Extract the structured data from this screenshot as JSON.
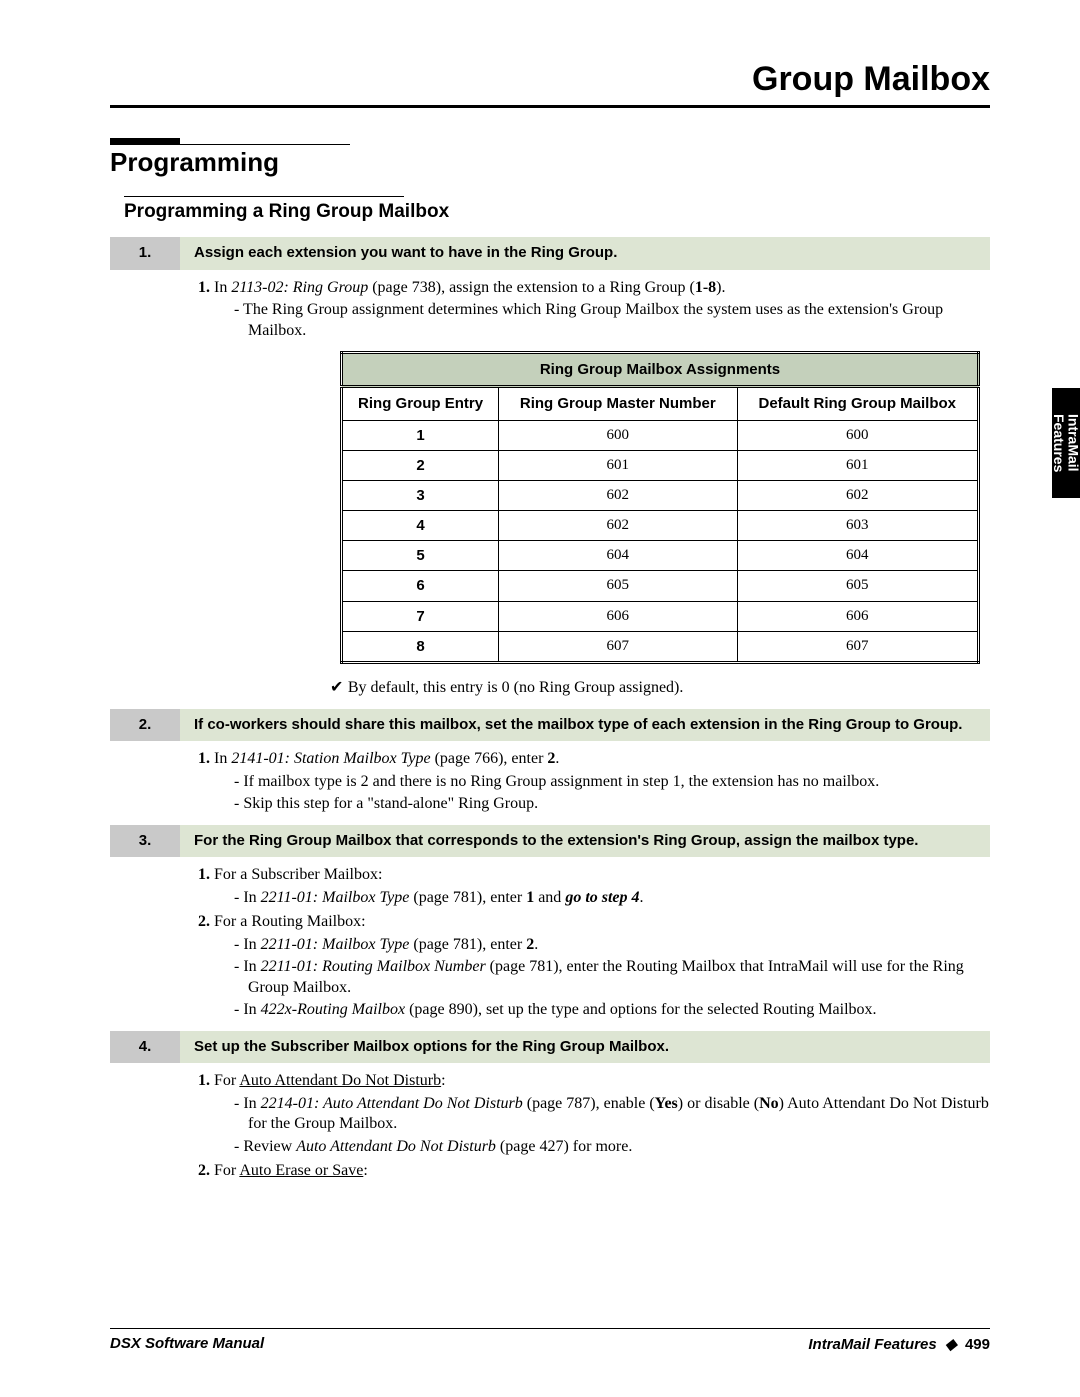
{
  "chapter_title": "Group Mailbox",
  "section_title": "Programming",
  "subsection_title": "Programming a Ring Group Mailbox",
  "sidetab": {
    "line1": "IntraMail",
    "line2": "Features"
  },
  "footer": {
    "left": "DSX Software Manual",
    "right_label": "IntraMail Features",
    "sep": "◆",
    "page": "499"
  },
  "steps": [
    {
      "num": "1.",
      "text": "Assign each extension you want to have in the Ring Group."
    },
    {
      "num": "2.",
      "text": "If co-workers should share this mailbox, set the mailbox type of each extension in the Ring Group to Group."
    },
    {
      "num": "3.",
      "text": "For the Ring Group Mailbox that corresponds to the extension's Ring Group, assign the mailbox type."
    },
    {
      "num": "4.",
      "text": "Set up the Subscriber Mailbox options for the Ring Group Mailbox."
    }
  ],
  "s1": {
    "lead_a": "In ",
    "lead_ref": "2113-02: Ring Group",
    "lead_b": " (page 738), assign the extension to a Ring Group (",
    "range": "1-8",
    "lead_c": ").",
    "dash1": "The Ring Group assignment determines which Ring Group Mailbox the system uses as the extension's Group Mailbox.",
    "note": "By default, this entry is 0 (no Ring Group assigned)."
  },
  "table": {
    "title": "Ring Group Mailbox Assignments",
    "cols": [
      "Ring Group Entry",
      "Ring Group Master Number",
      "Default Ring Group Mailbox"
    ],
    "rows": [
      [
        "1",
        "600",
        "600"
      ],
      [
        "2",
        "601",
        "601"
      ],
      [
        "3",
        "602",
        "602"
      ],
      [
        "4",
        "602",
        "603"
      ],
      [
        "5",
        "604",
        "604"
      ],
      [
        "6",
        "605",
        "605"
      ],
      [
        "7",
        "606",
        "606"
      ],
      [
        "8",
        "607",
        "607"
      ]
    ]
  },
  "s2": {
    "lead_a": "In ",
    "lead_ref": "2141-01: Station Mailbox Type",
    "lead_b": " (page 766), enter ",
    "val": "2",
    "lead_c": ".",
    "dash1": "If mailbox type is 2 and there is no Ring Group assignment in step 1, the extension has no mailbox.",
    "dash2": "Skip this step for a \"stand-alone\" Ring Group."
  },
  "s3": {
    "l1": "For a Subscriber Mailbox:",
    "l1d_a": "In ",
    "l1d_ref": "2211-01: Mailbox Type",
    "l1d_b": " (page 781), enter ",
    "l1d_v": "1",
    "l1d_c": " and ",
    "l1d_go": "go to step 4",
    "l1d_d": ".",
    "l2": "For a Routing Mailbox:",
    "l2d1_a": "In ",
    "l2d1_ref": "2211-01: Mailbox Type",
    "l2d1_b": " (page 781), enter ",
    "l2d1_v": "2",
    "l2d1_c": ".",
    "l2d2_a": "In ",
    "l2d2_ref": "2211-01: Routing Mailbox Number",
    "l2d2_b": " (page 781), enter the Routing Mailbox that IntraMail will use for the Ring Group Mailbox.",
    "l2d3_a": "In ",
    "l2d3_ref": "422x-Routing Mailbox",
    "l2d3_b": " (page 890), set up the type and options for the selected Routing Mailbox."
  },
  "s4": {
    "l1_a": "For ",
    "l1_u": "Auto Attendant Do Not Disturb",
    "l1_b": ":",
    "l1d1_a": "In ",
    "l1d1_ref": "2214-01: Auto Attendant Do Not Disturb",
    "l1d1_b": " (page 787), enable (",
    "l1d1_yes": "Yes",
    "l1d1_c": ") or disable (",
    "l1d1_no": "No",
    "l1d1_d": ") Auto Attendant Do Not Disturb for the Group Mailbox.",
    "l1d2_a": "Review ",
    "l1d2_ref": "Auto Attendant Do Not Disturb",
    "l1d2_b": " (page 427) for more.",
    "l2_a": "For ",
    "l2_u": "Auto Erase or Save",
    "l2_b": ":"
  }
}
